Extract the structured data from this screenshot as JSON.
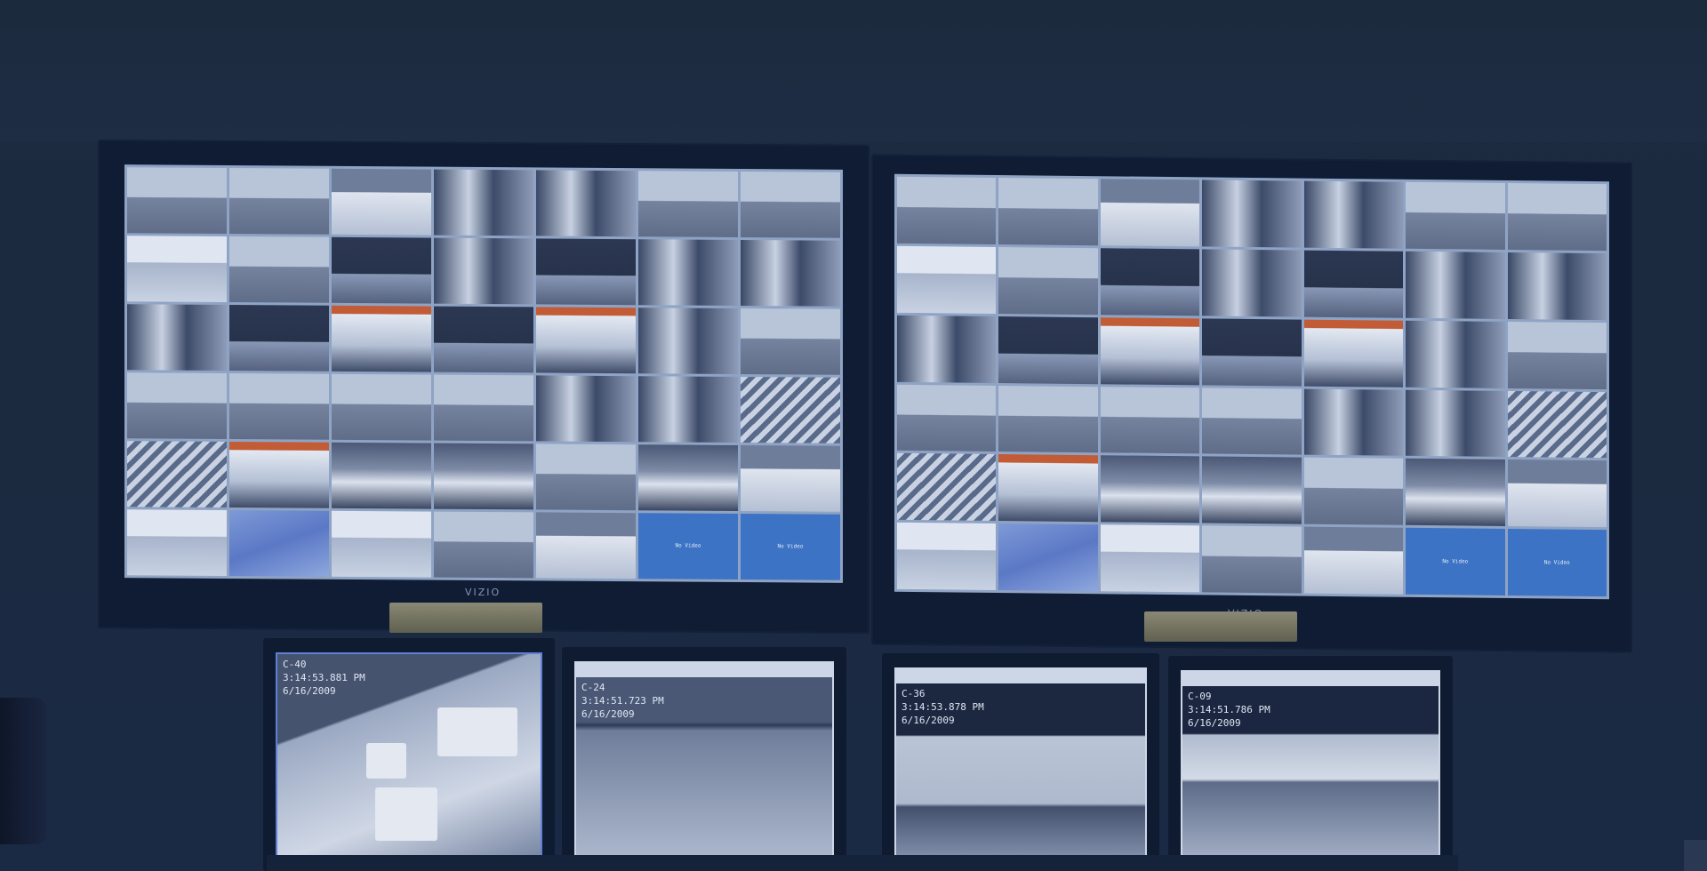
{
  "left_monitor": {
    "brand": "VIZIO",
    "tiles": [
      {
        "type": "sky"
      },
      {
        "type": "sky"
      },
      {
        "type": "lot"
      },
      {
        "type": "indoor"
      },
      {
        "type": "indoor"
      },
      {
        "type": "sky"
      },
      {
        "type": "sky"
      },
      {
        "type": "bright"
      },
      {
        "type": "sky"
      },
      {
        "type": "dark"
      },
      {
        "type": "indoor"
      },
      {
        "type": "dark"
      },
      {
        "type": "indoor"
      },
      {
        "type": "indoor"
      },
      {
        "type": "indoor"
      },
      {
        "type": "dark"
      },
      {
        "type": "lobby"
      },
      {
        "type": "dark"
      },
      {
        "type": "lobby"
      },
      {
        "type": "indoor"
      },
      {
        "type": "sky"
      },
      {
        "type": "sky"
      },
      {
        "type": "sky"
      },
      {
        "type": "sky"
      },
      {
        "type": "sky"
      },
      {
        "type": "indoor"
      },
      {
        "type": "indoor"
      },
      {
        "type": "stairs"
      },
      {
        "type": "stairs"
      },
      {
        "type": "lobby"
      },
      {
        "type": "people"
      },
      {
        "type": "people"
      },
      {
        "type": "sky"
      },
      {
        "type": "people"
      },
      {
        "type": "lot"
      },
      {
        "type": "bright"
      },
      {
        "type": "blue"
      },
      {
        "type": "bright"
      },
      {
        "type": "sky"
      },
      {
        "type": "lot"
      },
      {
        "type": "novideo",
        "text": "No Video"
      },
      {
        "type": "novideo",
        "text": "No Video"
      }
    ]
  },
  "right_monitor": {
    "brand": "VIZIO",
    "tiles": [
      {
        "type": "sky"
      },
      {
        "type": "sky"
      },
      {
        "type": "lot"
      },
      {
        "type": "indoor"
      },
      {
        "type": "indoor"
      },
      {
        "type": "sky"
      },
      {
        "type": "sky"
      },
      {
        "type": "bright"
      },
      {
        "type": "sky"
      },
      {
        "type": "dark"
      },
      {
        "type": "indoor"
      },
      {
        "type": "dark"
      },
      {
        "type": "indoor"
      },
      {
        "type": "indoor"
      },
      {
        "type": "indoor"
      },
      {
        "type": "dark"
      },
      {
        "type": "lobby"
      },
      {
        "type": "dark"
      },
      {
        "type": "lobby"
      },
      {
        "type": "indoor"
      },
      {
        "type": "sky"
      },
      {
        "type": "sky"
      },
      {
        "type": "sky"
      },
      {
        "type": "sky"
      },
      {
        "type": "sky"
      },
      {
        "type": "indoor"
      },
      {
        "type": "indoor"
      },
      {
        "type": "stairs"
      },
      {
        "type": "stairs"
      },
      {
        "type": "lobby"
      },
      {
        "type": "people"
      },
      {
        "type": "people"
      },
      {
        "type": "sky"
      },
      {
        "type": "people"
      },
      {
        "type": "lot"
      },
      {
        "type": "bright"
      },
      {
        "type": "blue"
      },
      {
        "type": "bright"
      },
      {
        "type": "sky"
      },
      {
        "type": "lot"
      },
      {
        "type": "novideo",
        "text": "No Video"
      },
      {
        "type": "novideo",
        "text": "No Video"
      }
    ]
  },
  "lower_monitors": [
    {
      "camera": "C-40",
      "time": "3:14:53.881 PM",
      "date": "6/16/2009"
    },
    {
      "camera": "C-24",
      "time": "3:14:51.723 PM",
      "date": "6/16/2009"
    },
    {
      "camera": "C-36",
      "time": "3:14:53.878 PM",
      "date": "6/16/2009"
    },
    {
      "camera": "C-09",
      "time": "3:14:51.786 PM",
      "date": "6/16/2009"
    }
  ],
  "colors": {
    "room": "#1c2a3f",
    "no_video": "#3c73c4"
  }
}
